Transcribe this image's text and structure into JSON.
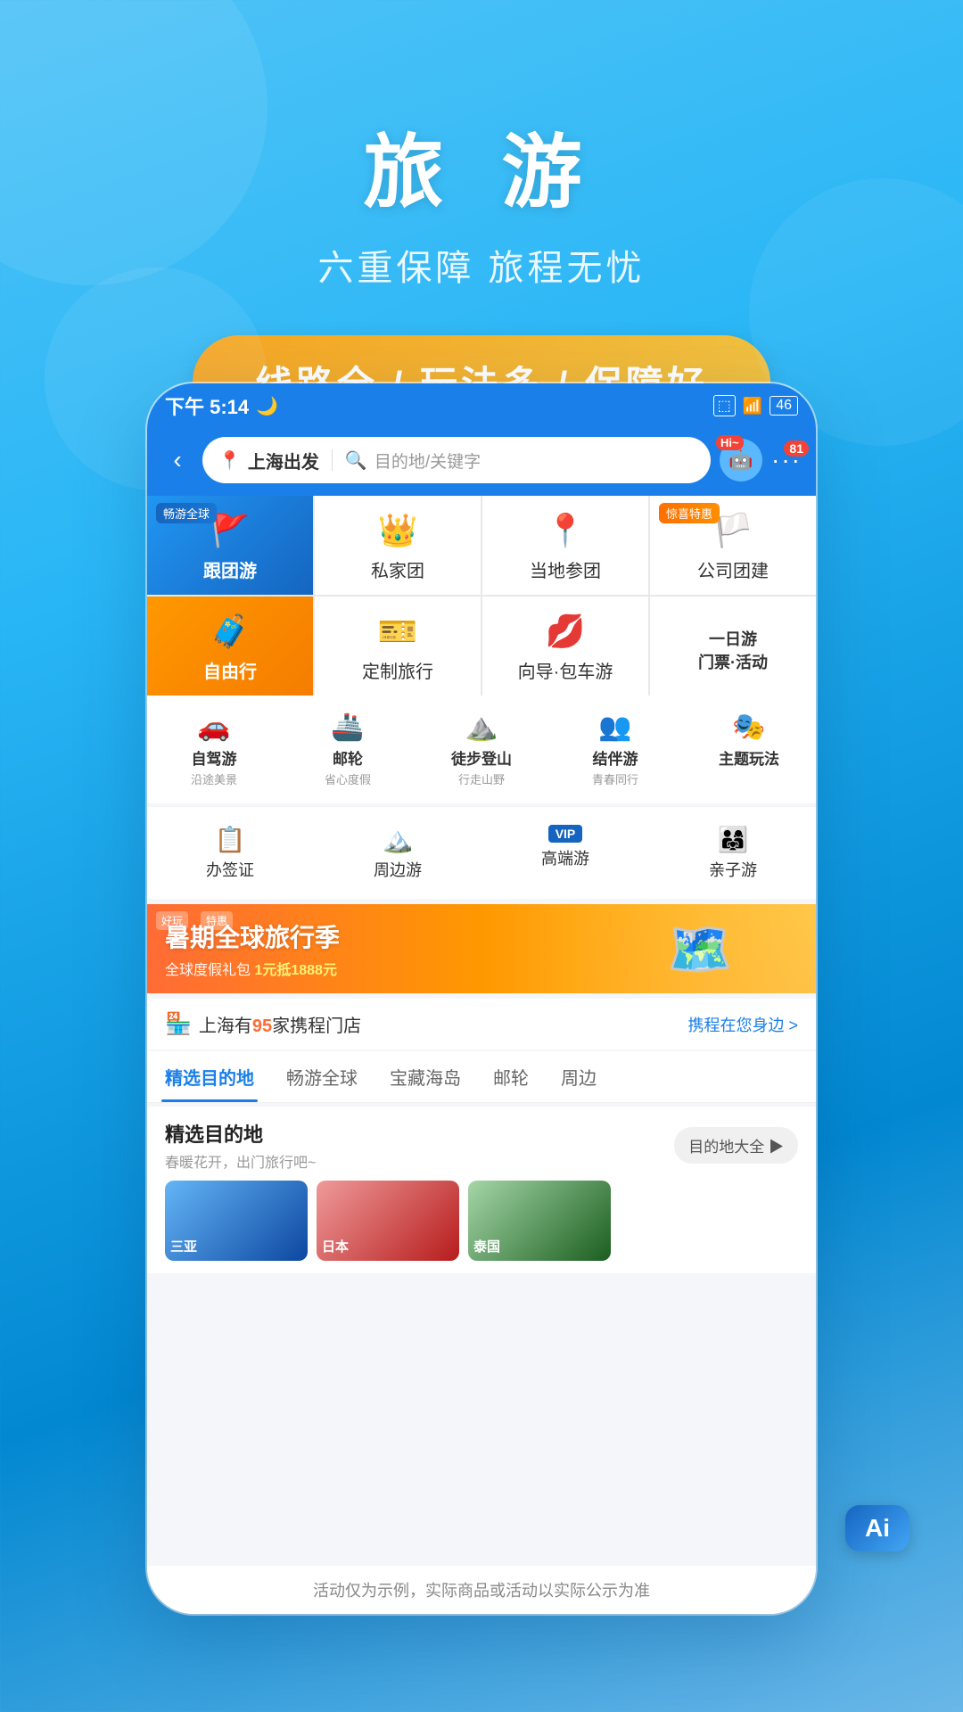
{
  "hero": {
    "title": "旅 游",
    "subtitle": "六重保障 旅程无忧",
    "banner_text": "线路全 / 玩法多 / 保障好"
  },
  "status_bar": {
    "time": "下午 5:14",
    "moon_icon": "🌙",
    "battery": "46",
    "wifi": "WiFi",
    "signal": "Signal"
  },
  "nav": {
    "back_icon": "‹",
    "origin": "上海出发",
    "search_placeholder": "目的地/关键字",
    "badge_hi": "Hi~",
    "badge_count": "81"
  },
  "menu_items": [
    {
      "label": "跟团游",
      "badge": "畅游全球",
      "bg": "blue",
      "icon": "🚩"
    },
    {
      "label": "私家团",
      "badge": "",
      "bg": "white",
      "icon": "👑"
    },
    {
      "label": "当地参团",
      "badge": "",
      "bg": "white",
      "icon": "📍"
    },
    {
      "label": "公司团建",
      "badge": "惊喜特惠",
      "bg": "white",
      "icon": "🏳️"
    },
    {
      "label": "自由行",
      "badge": "",
      "bg": "orange",
      "icon": "🧳"
    },
    {
      "label": "定制旅行",
      "badge": "",
      "bg": "white",
      "icon": "🎫"
    },
    {
      "label": "向导·包车游",
      "badge": "",
      "bg": "white",
      "icon": "💋"
    },
    {
      "label": "一日游\n门票·活动",
      "badge": "",
      "bg": "white",
      "icon": ""
    }
  ],
  "sub_menu": [
    {
      "icon": "🚗",
      "label": "自驾游",
      "desc": "沿途美景"
    },
    {
      "icon": "🚢",
      "label": "邮轮",
      "desc": "省心度假"
    },
    {
      "icon": "⛰️",
      "label": "徒步登山",
      "desc": "行走山野"
    },
    {
      "icon": "👥",
      "label": "结伴游",
      "desc": "青春同行"
    },
    {
      "icon": "🎭",
      "label": "主题玩法",
      "desc": ""
    }
  ],
  "service_items": [
    {
      "icon": "📋",
      "label": "办签证"
    },
    {
      "icon": "🏔️",
      "label": "周边游"
    },
    {
      "icon": "⭐",
      "label": "高端游",
      "badge": "VIP"
    },
    {
      "icon": "👨‍👩‍👧",
      "label": "亲子游"
    }
  ],
  "promo": {
    "title": "暑期全球旅行季",
    "sub1": "全球度假礼包",
    "highlight": "1元抵1888元"
  },
  "store": {
    "prefix": "上海有",
    "count": "95",
    "suffix": "家携程门店",
    "link": "携程在您身边 >"
  },
  "tabs": [
    {
      "label": "精选目的地",
      "active": true
    },
    {
      "label": "畅游全球",
      "active": false
    },
    {
      "label": "宝藏海岛",
      "active": false
    },
    {
      "label": "邮轮",
      "active": false
    },
    {
      "label": "周边",
      "active": false
    }
  ],
  "destination": {
    "title": "精选目的地",
    "subtitle": "春暖花开，出门旅行吧~",
    "all_btn": "目的地大全 ▶"
  },
  "disclaimer": "活动仅为示例，实际商品或活动以实际公示为准",
  "ai_label": "Ai",
  "dest_cards": [
    {
      "name": "三亚",
      "color1": "#64b5f6",
      "color2": "#0d47a1"
    },
    {
      "name": "日本",
      "color1": "#ef9a9a",
      "color2": "#b71c1c"
    },
    {
      "name": "泰国",
      "color1": "#a5d6a7",
      "color2": "#1b5e20"
    }
  ]
}
